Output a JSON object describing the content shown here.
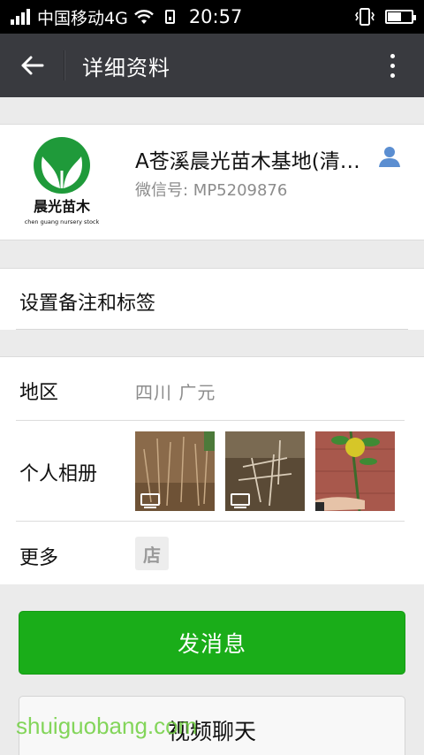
{
  "status_bar": {
    "carrier": "中国移动4G",
    "time": "20:57",
    "battery_level": 0.55
  },
  "title_bar": {
    "title": "详细资料"
  },
  "profile": {
    "name": "A苍溪晨光苗木基地(清…",
    "wechat_id": "微信号: MP5209876",
    "avatar_logo_cn": "晨光苗木",
    "avatar_logo_en": "chen guang nursery stock"
  },
  "remark": {
    "label": "设置备注和标签"
  },
  "info": {
    "region_label": "地区",
    "region_value": "四川  广元",
    "album_label": "个人相册",
    "more_label": "更多",
    "shop_icon_text": "店"
  },
  "actions": {
    "send_message": "发消息",
    "video_chat": "视频聊天"
  },
  "watermark": "shuiguobang.com",
  "colors": {
    "primary_green": "#1aad19",
    "title_bar_bg": "#393a3f",
    "page_bg": "#ebebeb"
  }
}
